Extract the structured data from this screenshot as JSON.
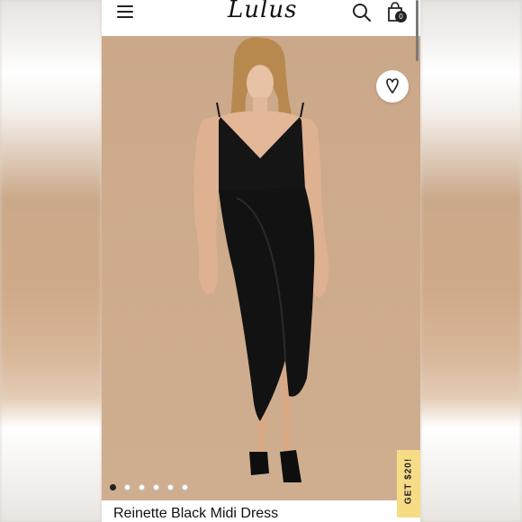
{
  "header": {
    "logo_text": "Lulus",
    "menu_icon": "hamburger-menu-icon",
    "search_icon": "search-icon",
    "bag_icon": "shopping-bag-icon",
    "bag_count": "0"
  },
  "product": {
    "name": "Reinette Black Midi Dress",
    "favorite_icon": "heart-icon",
    "image_count": 6,
    "active_image": 1
  },
  "promo": {
    "label": "GET $20!",
    "color": "#f7dc86"
  },
  "colors": {
    "photo_background": "#cbaa8b",
    "dress": "#151515"
  }
}
